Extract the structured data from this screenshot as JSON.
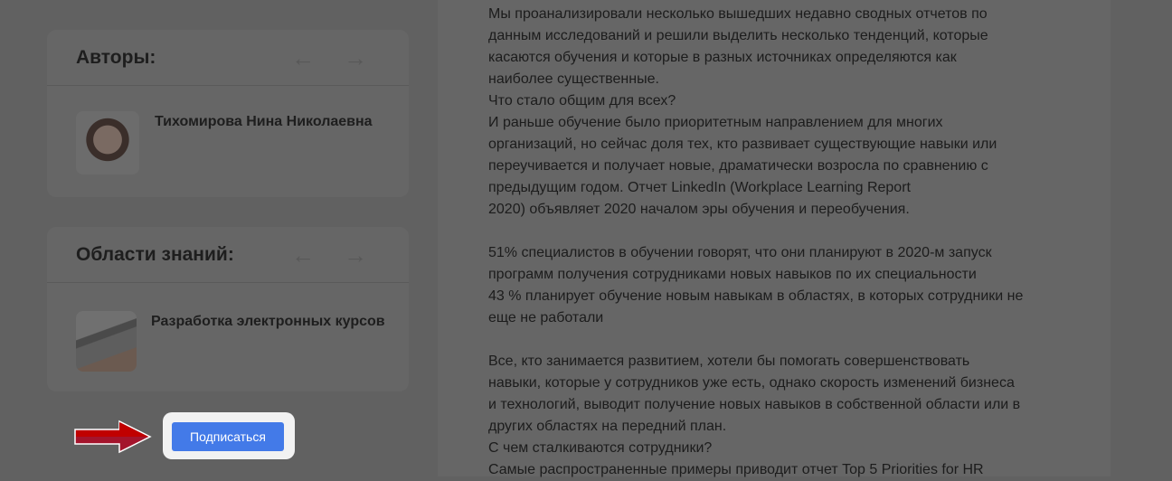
{
  "authors": {
    "title": "Авторы:",
    "items": [
      {
        "name": "Тихомирова Нина Николаевна"
      }
    ]
  },
  "areas": {
    "title": "Области знаний:",
    "items": [
      {
        "name": "Разработка электронных курсов"
      }
    ]
  },
  "subscribe_label": "Подписаться",
  "article": {
    "lines": [
      "Мы проанализировали несколько вышедших недавно сводных отчетов по",
      "данным исследований и решили выделить несколько тенденций, которые",
      "касаются обучения и которые в разных источниках определяются как",
      "наиболее существенные.",
      "Что стало общим для всех?",
      "И раньше обучение было приоритетным направлением для многих",
      "организаций, но сейчас доля тех, кто развивает существующие навыки или",
      "переучивается и получает новые, драматически возросла по сравнению с",
      "предыдущим годом. Отчет LinkedIn (Workplace Learning Report",
      "2020) объявляет 2020 началом эры обучения и переобучения.",
      "",
      "51% специалистов в обучении говорят, что они планируют в 2020-м запуск",
      "программ получения сотрудниками новых навыков по их специальности",
      "43 % планирует обучение новым навыкам в областях, в которых сотрудники не",
      "еще не работали",
      "",
      "Все, кто занимается развитием, хотели бы помогать совершенствовать",
      "навыки, которые у сотрудников уже есть, однако скорость изменений бизнеса",
      "и технологий, выводит получение новых навыков в собственной области или в",
      "других областях на передний план.",
      "С чем сталкиваются сотрудники?",
      "Самые распространенные примеры приводит отчет Top 5 Priorities for HR"
    ]
  },
  "colors": {
    "button": "#437ae8",
    "pointer": "#c00000"
  }
}
